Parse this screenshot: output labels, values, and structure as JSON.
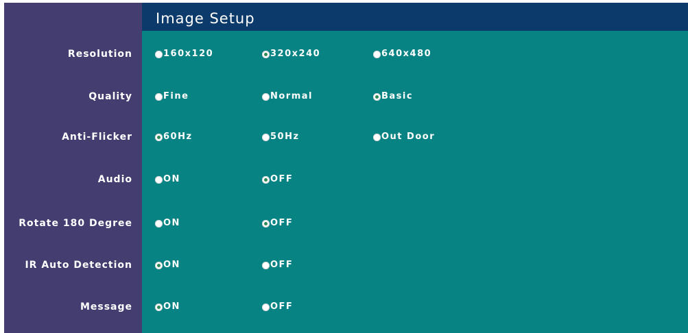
{
  "title": "Image Setup",
  "colors": {
    "label_column": "#433d70",
    "content_area": "#088383",
    "title_bar": "#0b3a6b",
    "text": "#ffffff",
    "radio_selected_dot": "#2e8b57"
  },
  "rows": [
    {
      "label": "Resolution",
      "options": [
        {
          "label": "160x120",
          "selected": false
        },
        {
          "label": "320x240",
          "selected": true
        },
        {
          "label": "640x480",
          "selected": false
        }
      ]
    },
    {
      "label": "Quality",
      "options": [
        {
          "label": "Fine",
          "selected": false
        },
        {
          "label": "Normal",
          "selected": false
        },
        {
          "label": "Basic",
          "selected": true
        }
      ]
    },
    {
      "label": "Anti-Flicker",
      "options": [
        {
          "label": "60Hz",
          "selected": true
        },
        {
          "label": "50Hz",
          "selected": false
        },
        {
          "label": "Out Door",
          "selected": false
        }
      ]
    },
    {
      "label": "Audio",
      "options": [
        {
          "label": "ON",
          "selected": false
        },
        {
          "label": "OFF",
          "selected": true
        }
      ]
    },
    {
      "label": "Rotate 180 Degree",
      "options": [
        {
          "label": "ON",
          "selected": false
        },
        {
          "label": "OFF",
          "selected": true
        }
      ]
    },
    {
      "label": "IR Auto Detection",
      "options": [
        {
          "label": "ON",
          "selected": true
        },
        {
          "label": "OFF",
          "selected": false
        }
      ]
    },
    {
      "label": "Message",
      "options": [
        {
          "label": "ON",
          "selected": true
        },
        {
          "label": "OFF",
          "selected": false
        }
      ]
    }
  ]
}
